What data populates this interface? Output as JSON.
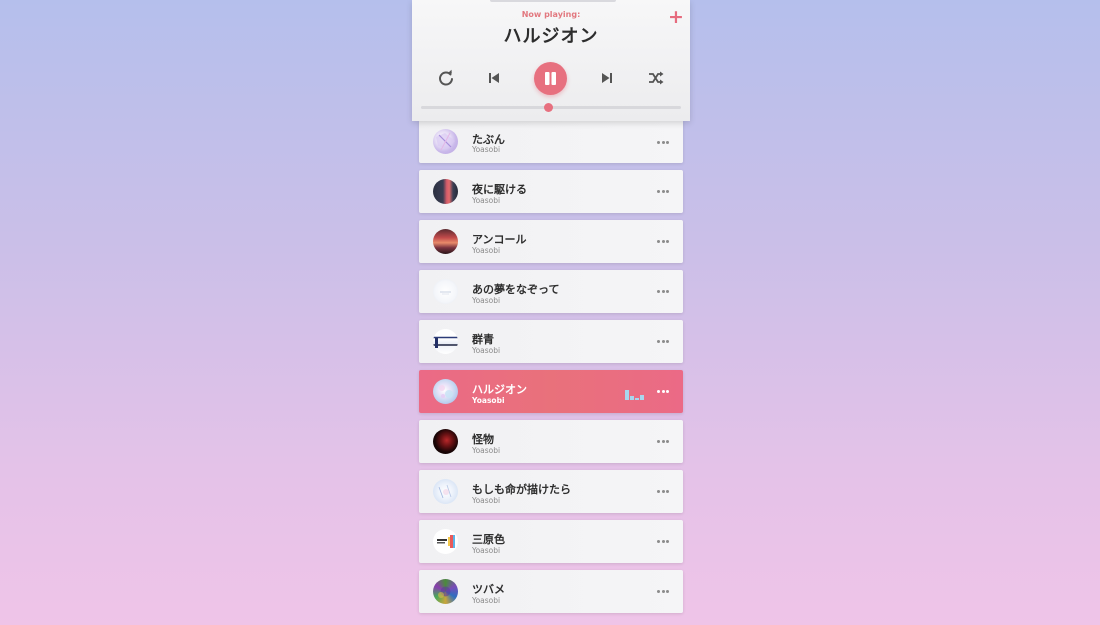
{
  "player": {
    "now_playing_label": "Now playing:",
    "title": "ハルジオン",
    "add_label": "+",
    "progress": 0.49,
    "accent_color": "#e7707f",
    "controls": [
      "repeat-icon",
      "previous-icon",
      "pause-icon",
      "next-icon",
      "shuffle-icon"
    ]
  },
  "songs": [
    {
      "title": "たぶん",
      "artist": "Yoasobi",
      "active": false
    },
    {
      "title": "夜に駆ける",
      "artist": "Yoasobi",
      "active": false
    },
    {
      "title": "アンコール",
      "artist": "Yoasobi",
      "active": false
    },
    {
      "title": "あの夢をなぞって",
      "artist": "Yoasobi",
      "active": false
    },
    {
      "title": "群青",
      "artist": "Yoasobi",
      "active": false
    },
    {
      "title": "ハルジオン",
      "artist": "Yoasobi",
      "active": true
    },
    {
      "title": "怪物",
      "artist": "Yoasobi",
      "active": false
    },
    {
      "title": "もしも命が描けたら",
      "artist": "Yoasobi",
      "active": false
    },
    {
      "title": "三原色",
      "artist": "Yoasobi",
      "active": false
    },
    {
      "title": "ツバメ",
      "artist": "Yoasobi",
      "active": false
    }
  ]
}
